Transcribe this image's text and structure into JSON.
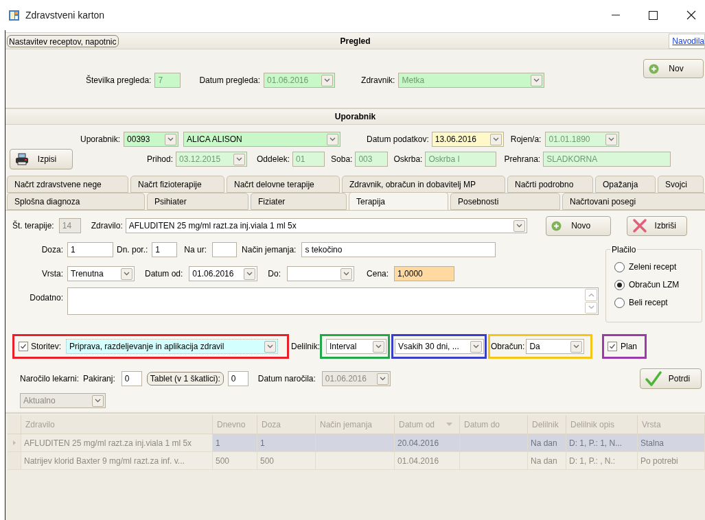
{
  "window": {
    "title": "Zdravstveni karton"
  },
  "settings_button": "Nastavitev receptov, napotnic",
  "help_link": "Navodila",
  "pregled": {
    "heading": "Pregled",
    "new_button": "Nov",
    "number": {
      "label": "Številka pregleda:",
      "value": "7",
      "disabled": true
    },
    "date": {
      "label": "Datum pregleda:",
      "value": "01.06.2016",
      "disabled": true
    },
    "doctor": {
      "label": "Zdravnik:",
      "value": "Metka",
      "disabled": true
    }
  },
  "uporabnik": {
    "heading": "Uporabnik",
    "print_button": "Izpisi",
    "user_id": {
      "label": "Uporabnik:",
      "value": "00393",
      "disabled": false
    },
    "user_name": {
      "value": "ALICA ALISON",
      "disabled": false
    },
    "data_date": {
      "label": "Datum podatkov:",
      "value": "13.06.2016",
      "disabled": false
    },
    "born": {
      "label": "Rojen/a:",
      "value": "01.01.1890",
      "disabled": true
    },
    "arrival": {
      "label": "Prihod:",
      "value": "03.12.2015",
      "disabled": true
    },
    "department": {
      "label": "Oddelek:",
      "value": "01",
      "disabled": true
    },
    "room": {
      "label": "Soba:",
      "value": "003",
      "disabled": true
    },
    "care": {
      "label": "Oskrba:",
      "value": "Oskrba I",
      "disabled": true
    },
    "diet": {
      "label": "Prehrana:",
      "value": "SLADKORNA",
      "disabled": true
    }
  },
  "tab_rows": [
    {
      "tabs": [
        {
          "label": "Načrt zdravstvene nege",
          "selected": false
        },
        {
          "label": "Načrt fizioterapije",
          "selected": false
        },
        {
          "label": "Načrt delovne terapije",
          "selected": false
        },
        {
          "label": "Zdravnik, obračun in dobavitelj MP",
          "selected": false
        },
        {
          "label": "Načrti podrobno",
          "selected": false
        },
        {
          "label": "Opažanja",
          "selected": false
        },
        {
          "label": "Svojci",
          "selected": false
        }
      ]
    },
    {
      "tabs": [
        {
          "label": "Splošna diagnoza",
          "selected": false
        },
        {
          "label": "Psihiater",
          "selected": false
        },
        {
          "label": "Fiziater",
          "selected": false
        },
        {
          "label": "Terapija",
          "selected": true
        },
        {
          "label": "Posebnosti",
          "selected": false
        },
        {
          "label": "Načrtovani posegi",
          "selected": false
        }
      ]
    }
  ],
  "therapy": {
    "number": {
      "label": "Št. terapije:",
      "value": "14",
      "disabled": true
    },
    "drug": {
      "label": "Zdravilo:",
      "value": "AFLUDITEN 25 mg/ml razt.za inj.viala 1 ml 5x",
      "disabled": false
    },
    "new_button": "Novo",
    "delete_button": "Izbriši",
    "dose": {
      "label": "Doza:",
      "value": "1"
    },
    "daily": {
      "label": "Dn. por.:",
      "value": "1"
    },
    "hours": {
      "label": "Na ur:"
    },
    "method": {
      "label": "Način jemanja:",
      "value": "s tekočino"
    },
    "type": {
      "label": "Vrsta:",
      "value": "Trenutna"
    },
    "date_from": {
      "label": "Datum od:",
      "value": "01.06.2016"
    },
    "date_to": {
      "label": "Do:"
    },
    "price": {
      "label": "Cena:",
      "value": "1,0000"
    },
    "notes": {
      "label": "Dodatno:"
    },
    "payment": {
      "title": "Plačilo",
      "options": [
        {
          "label": "Zeleni recept",
          "selected": false
        },
        {
          "label": "Obračun LZM",
          "selected": true
        },
        {
          "label": "Beli recept",
          "selected": false
        }
      ]
    },
    "service": {
      "label": "Storitev:",
      "checked": true,
      "value": "Priprava, razdeljevanje in aplikacija zdravil"
    },
    "divider": {
      "label": "Delilnik:",
      "value": "Interval"
    },
    "interval": {
      "value": "Vsakih 30 dni, ..."
    },
    "billing": {
      "label": "Obračun:",
      "value": "Da"
    },
    "plan": {
      "label": "Plan",
      "checked": true
    },
    "order": {
      "label": "Naročilo lekarni:",
      "packs": {
        "label": "Pakiranj:",
        "value": "0"
      },
      "tablets_button": "Tablet (v 1 škatlici):",
      "tablets": {
        "value": "0"
      },
      "date": {
        "label": "Datum naročila:",
        "value": "01.06.2016",
        "disabled": true
      }
    },
    "confirm_button": "Potrdi",
    "filter": {
      "value": "Aktualno",
      "disabled": true
    }
  },
  "table": {
    "columns": [
      {
        "label": "Zdravilo",
        "sorted": false
      },
      {
        "label": "Dnevno",
        "sorted": false
      },
      {
        "label": "Doza",
        "sorted": false
      },
      {
        "label": "Način jemanja",
        "sorted": false
      },
      {
        "label": "Datum od",
        "sorted": true
      },
      {
        "label": "Datum do",
        "sorted": false
      },
      {
        "label": "Delilnik",
        "sorted": false
      },
      {
        "label": "Delilnik opis",
        "sorted": false
      },
      {
        "label": "Vrsta",
        "sorted": false
      }
    ],
    "rows": [
      {
        "selected": true,
        "cells": [
          "AFLUDITEN 25 mg/ml razt.za inj.viala 1 ml 5x",
          "1",
          "1",
          null,
          "20.04.2016",
          null,
          "Na dan",
          "D: 1, P.: 1, N...",
          "Stalna"
        ]
      },
      {
        "selected": false,
        "cells": [
          "Natrijev klorid Baxter 9 mg/ml razt.za inf. v...",
          "500",
          "500",
          null,
          "01.04.2016",
          null,
          "Na dan",
          "D: 1, P.: , N.:",
          "Po potrebi"
        ]
      }
    ]
  }
}
